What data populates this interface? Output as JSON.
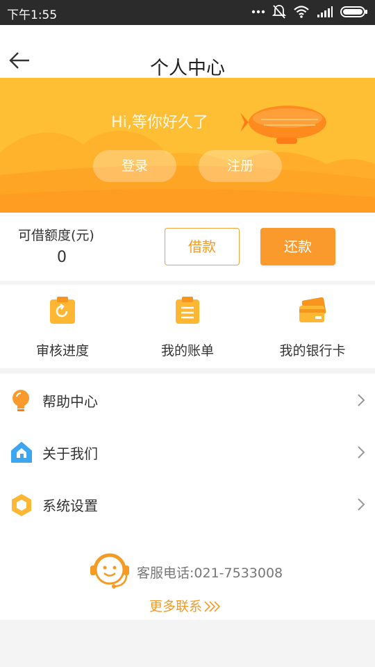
{
  "status_bar": {
    "time": "下午1:55"
  },
  "header": {
    "title": "个人中心"
  },
  "banner": {
    "greeting": "Hi,等你好久了",
    "login_label": "登录",
    "register_label": "注册",
    "background_color": "#ffbf34"
  },
  "credit": {
    "label": "可借额度(元)",
    "value": "0",
    "borrow_label": "借款",
    "repay_label": "还款",
    "accent_color": "#fb9a2c"
  },
  "quick_actions": [
    {
      "label": "审核进度",
      "icon": "review-progress-icon"
    },
    {
      "label": "我的账单",
      "icon": "bill-icon"
    },
    {
      "label": "我的银行卡",
      "icon": "bank-card-icon"
    }
  ],
  "menu": [
    {
      "label": "帮助中心",
      "icon": "lightbulb-icon"
    },
    {
      "label": "关于我们",
      "icon": "home-icon"
    },
    {
      "label": "系统设置",
      "icon": "settings-hexagon-icon"
    }
  ],
  "support": {
    "phone_text": "客服电话:021-7533008",
    "more_label": "更多联系"
  }
}
